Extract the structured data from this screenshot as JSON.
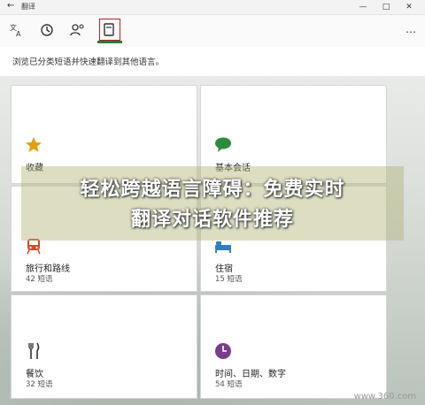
{
  "window": {
    "title": "翻译",
    "back_glyph": "←",
    "minimize": "—",
    "maximize": "□",
    "close": "✕"
  },
  "toolbar": {
    "tools": [
      {
        "name": "translate-icon"
      },
      {
        "name": "history-icon"
      },
      {
        "name": "conversation-icon"
      },
      {
        "name": "phrasebook-icon",
        "active": true
      }
    ],
    "more": "⋯"
  },
  "subtitle": "浏览已分类短语并快速翻译到其他语言。",
  "categories": [
    {
      "label": "收藏",
      "count": "",
      "icon": "star-icon",
      "color": "#e0a010"
    },
    {
      "label": "基本会话",
      "count": "",
      "icon": "chat-bubble-icon",
      "color": "#2e8b3e"
    },
    {
      "label": "旅行和路线",
      "count": "42 短语",
      "icon": "train-icon",
      "color": "#d24b2b"
    },
    {
      "label": "住宿",
      "count": "15 短语",
      "icon": "bed-icon",
      "color": "#2e7fc2"
    },
    {
      "label": "餐饮",
      "count": "32 短语",
      "icon": "fork-knife-icon",
      "color": "#333333"
    },
    {
      "label": "时间、日期、数字",
      "count": "54 短语",
      "icon": "clock-icon",
      "color": "#7a3d8c"
    }
  ],
  "banner": {
    "line1": "轻松跨越语言障碍：免费实时",
    "line2": "翻译对话软件推荐"
  },
  "watermark": "www.360.com"
}
